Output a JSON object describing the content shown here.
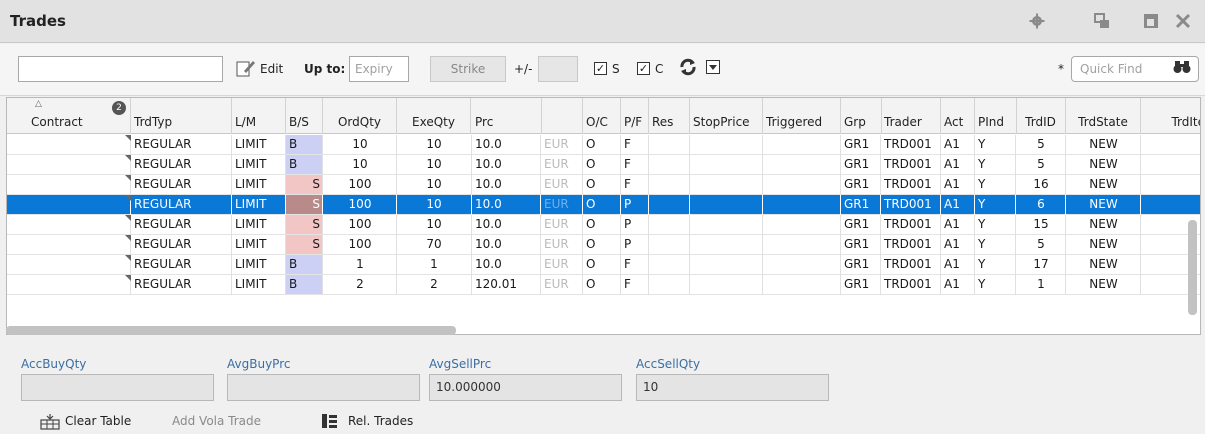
{
  "window": {
    "title": "Trades",
    "icons": [
      "gear-icon",
      "restore-icon",
      "maximize-icon",
      "close-icon"
    ]
  },
  "toolbar": {
    "filter_value": "",
    "edit_label": "Edit",
    "upto_label": "Up to:",
    "expiry_placeholder": "Expiry",
    "strike_label": "Strike",
    "plusminus_label": "+/-",
    "plusminus_value": "",
    "check_s_label": "S",
    "check_c_label": "C",
    "star_label": "*",
    "quickfind_placeholder": "Quick Find"
  },
  "table": {
    "header_badge": "2",
    "headers": [
      "Contract",
      "TrdTyp",
      "L/M",
      "B/S",
      "OrdQty",
      "ExeQty",
      "Prc",
      "",
      "O/C",
      "P/F",
      "Res",
      "StopPrice",
      "Triggered",
      "Grp",
      "Trader",
      "Act",
      "PInd",
      "TrdID",
      "TrdState",
      "TrdIte"
    ],
    "rows": [
      {
        "contract": "",
        "trdtyp": "REGULAR",
        "lm": "LIMIT",
        "bs": "B",
        "ordqty": "10",
        "exeqty": "10",
        "prc": "10.0",
        "cur": "EUR",
        "oc": "O",
        "pf": "F",
        "res": "",
        "stop": "",
        "trig": "",
        "grp": "GR1",
        "trader": "TRD001",
        "act": "A1",
        "pind": "Y",
        "trdid": "5",
        "state": "NEW",
        "trdite": ""
      },
      {
        "contract": "",
        "trdtyp": "REGULAR",
        "lm": "LIMIT",
        "bs": "B",
        "ordqty": "10",
        "exeqty": "10",
        "prc": "10.0",
        "cur": "EUR",
        "oc": "O",
        "pf": "F",
        "res": "",
        "stop": "",
        "trig": "",
        "grp": "GR1",
        "trader": "TRD001",
        "act": "A1",
        "pind": "Y",
        "trdid": "5",
        "state": "NEW",
        "trdite": ""
      },
      {
        "contract": "",
        "trdtyp": "REGULAR",
        "lm": "LIMIT",
        "bs": "S",
        "ordqty": "100",
        "exeqty": "10",
        "prc": "10.0",
        "cur": "EUR",
        "oc": "O",
        "pf": "F",
        "res": "",
        "stop": "",
        "trig": "",
        "grp": "GR1",
        "trader": "TRD001",
        "act": "A1",
        "pind": "Y",
        "trdid": "16",
        "state": "NEW",
        "trdite": ":"
      },
      {
        "contract": "",
        "trdtyp": "REGULAR",
        "lm": "LIMIT",
        "bs": "S",
        "ordqty": "100",
        "exeqty": "10",
        "prc": "10.0",
        "cur": "EUR",
        "oc": "O",
        "pf": "P",
        "res": "",
        "stop": "",
        "trig": "",
        "grp": "GR1",
        "trader": "TRD001",
        "act": "A1",
        "pind": "Y",
        "trdid": "6",
        "state": "NEW",
        "trdite": "",
        "selected": true
      },
      {
        "contract": "",
        "trdtyp": "REGULAR",
        "lm": "LIMIT",
        "bs": "S",
        "ordqty": "100",
        "exeqty": "10",
        "prc": "10.0",
        "cur": "EUR",
        "oc": "O",
        "pf": "P",
        "res": "",
        "stop": "",
        "trig": "",
        "grp": "GR1",
        "trader": "TRD001",
        "act": "A1",
        "pind": "Y",
        "trdid": "15",
        "state": "NEW",
        "trdite": ":"
      },
      {
        "contract": "",
        "trdtyp": "REGULAR",
        "lm": "LIMIT",
        "bs": "S",
        "ordqty": "100",
        "exeqty": "70",
        "prc": "10.0",
        "cur": "EUR",
        "oc": "O",
        "pf": "P",
        "res": "",
        "stop": "",
        "trig": "",
        "grp": "GR1",
        "trader": "TRD001",
        "act": "A1",
        "pind": "Y",
        "trdid": "5",
        "state": "NEW",
        "trdite": ""
      },
      {
        "contract": "",
        "trdtyp": "REGULAR",
        "lm": "LIMIT",
        "bs": "B",
        "ordqty": "1",
        "exeqty": "1",
        "prc": "10.0",
        "cur": "EUR",
        "oc": "O",
        "pf": "F",
        "res": "",
        "stop": "",
        "trig": "",
        "grp": "GR1",
        "trader": "TRD001",
        "act": "A1",
        "pind": "Y",
        "trdid": "17",
        "state": "NEW",
        "trdite": "·"
      },
      {
        "contract": "",
        "trdtyp": "REGULAR",
        "lm": "LIMIT",
        "bs": "B",
        "ordqty": "2",
        "exeqty": "2",
        "prc": "120.01",
        "cur": "EUR",
        "oc": "O",
        "pf": "F",
        "res": "",
        "stop": "",
        "trig": "",
        "grp": "GR1",
        "trader": "TRD001",
        "act": "A1",
        "pind": "Y",
        "trdid": "1",
        "state": "NEW",
        "trdite": ""
      }
    ]
  },
  "summary": {
    "acc_buy_qty_label": "AccBuyQty",
    "acc_buy_qty_value": "",
    "avg_buy_prc_label": "AvgBuyPrc",
    "avg_buy_prc_value": "",
    "avg_sell_prc_label": "AvgSellPrc",
    "avg_sell_prc_value": "10.000000",
    "acc_sell_qty_label": "AccSellQty",
    "acc_sell_qty_value": "10"
  },
  "bottom": {
    "clear_table_label": "Clear Table",
    "add_vola_label": "Add Vola Trade",
    "rel_trades_label": "Rel. Trades"
  },
  "colors": {
    "selection": "#0a78d7",
    "buy": "#cbd0f4",
    "sell": "#f3c6c6",
    "summary_label": "#3a6ea5"
  }
}
